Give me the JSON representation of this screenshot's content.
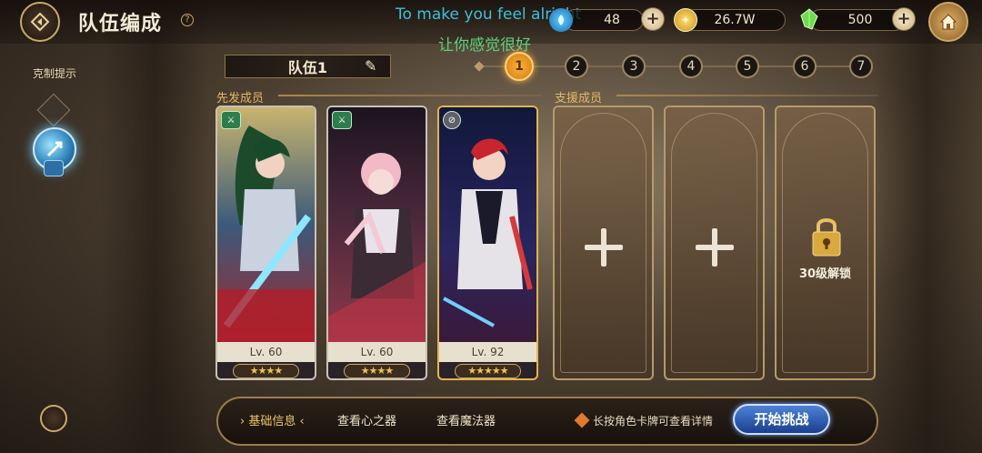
{
  "header": {
    "title": "队伍编成",
    "help_icon": "?",
    "resources": [
      {
        "name": "stamina",
        "icon": "stamina-icon",
        "value": "48"
      },
      {
        "name": "gold",
        "icon": "gold-coin-icon",
        "value": "26.7W"
      },
      {
        "name": "gems",
        "icon": "green-crystal-icon",
        "value": "500"
      }
    ]
  },
  "overlay": {
    "english": "To make you feel alright",
    "chinese": "让你感觉很好"
  },
  "sidebar": {
    "hint_label": "克制提示"
  },
  "team": {
    "name": "队伍1",
    "steps": [
      "1",
      "2",
      "3",
      "4",
      "5",
      "6",
      "7"
    ],
    "active_step": "1"
  },
  "sections": {
    "starters": "先发成员",
    "support": "支援成员"
  },
  "cards": [
    {
      "level": "Lv. 60",
      "stars": "★★★★",
      "badge": "green"
    },
    {
      "level": "Lv. 60",
      "stars": "★★★★",
      "badge": "green"
    },
    {
      "level": "Lv. 92",
      "stars": "★★★★★",
      "badge": "grey"
    }
  ],
  "support_slots": [
    {
      "state": "empty"
    },
    {
      "state": "empty"
    },
    {
      "state": "locked",
      "label": "30级解锁"
    }
  ],
  "bottom": {
    "tabs": [
      "基础信息",
      "查看心之器",
      "查看魔法器"
    ],
    "active_tab": "基础信息",
    "hint": "长按角色卡牌可查看详情",
    "start_button": "开始挑战"
  },
  "colors": {
    "accent_gold": "#e2b863",
    "start_blue": "#1b3f8c",
    "active_step": "#f7b43a"
  }
}
